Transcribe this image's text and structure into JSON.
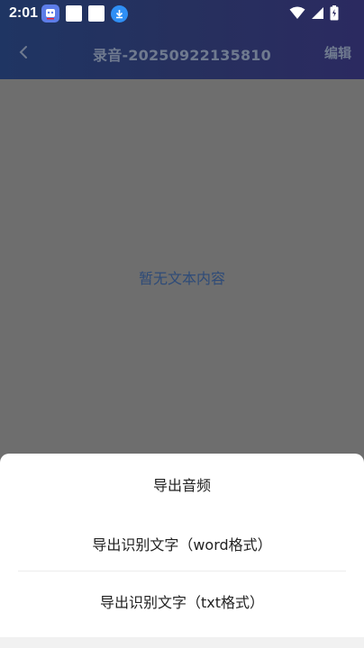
{
  "status_bar": {
    "time": "2:01",
    "icons_left": [
      "app-notification-icon",
      "blank-square-icon",
      "blank-square-icon",
      "download-icon"
    ],
    "icons_right": [
      "wifi-icon",
      "signal-icon",
      "battery-icon"
    ]
  },
  "header": {
    "title": "录音-20250922135810",
    "edit_label": "编辑",
    "gradient_colors": [
      "#1f3563",
      "#2b2a60"
    ]
  },
  "content": {
    "empty_text": "暂无文本内容",
    "overlay_color": "#6e6e6e"
  },
  "bottom_sheet": {
    "items": [
      {
        "label": "导出音频"
      },
      {
        "label": "导出识别文字（word格式）"
      },
      {
        "label": "导出识别文字（txt格式）"
      }
    ]
  }
}
